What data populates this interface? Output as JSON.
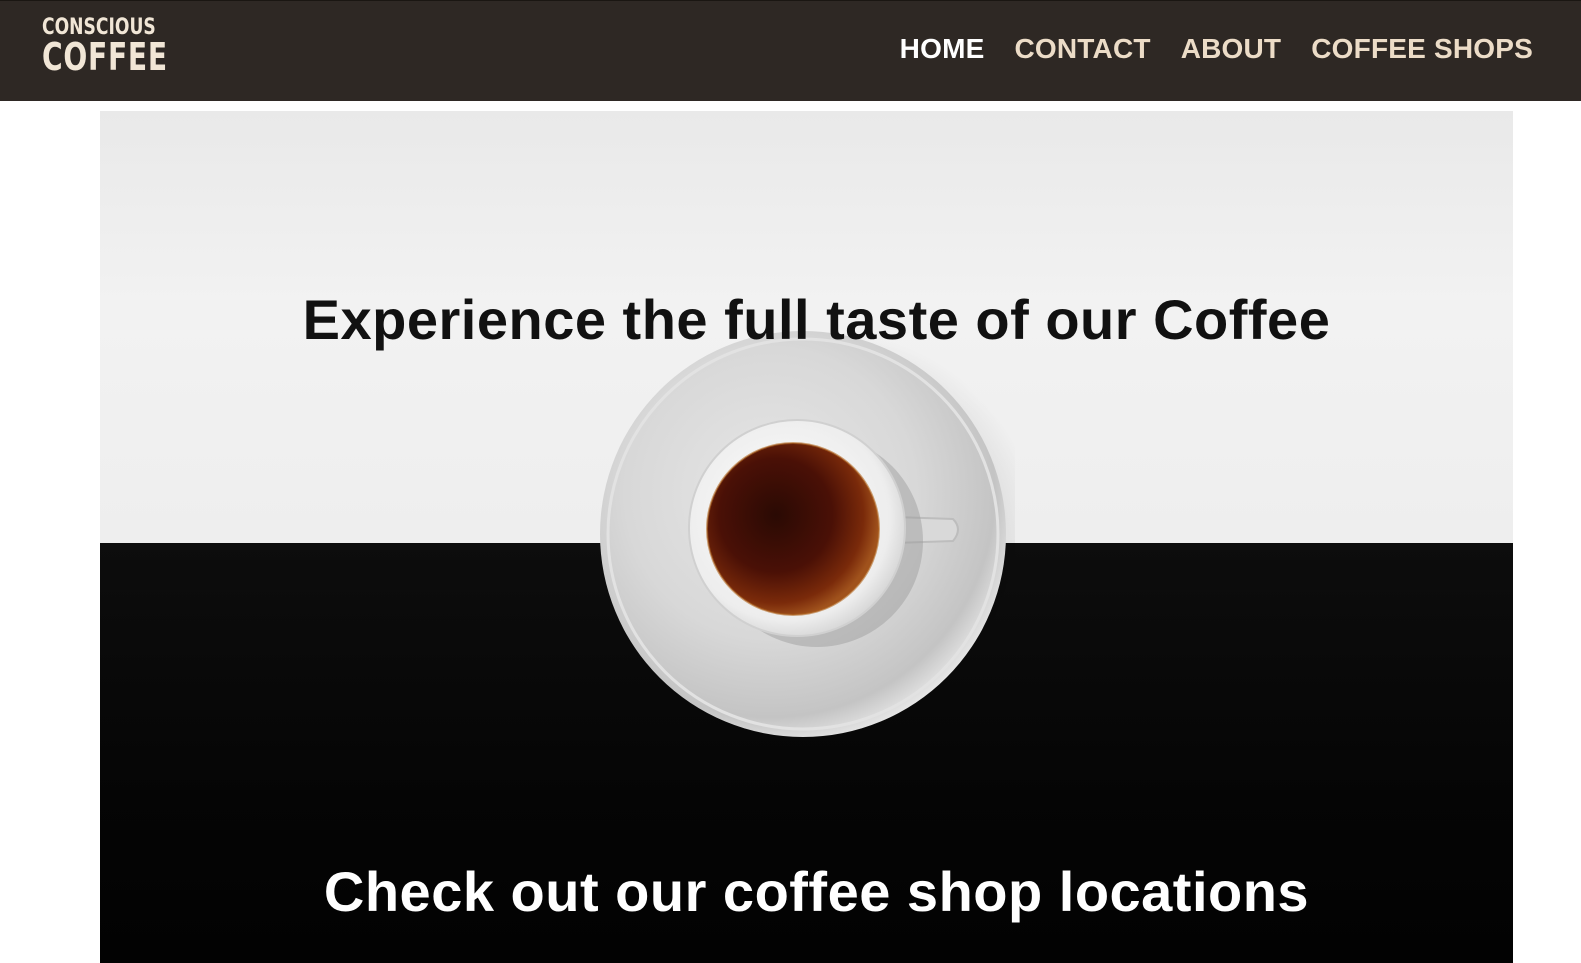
{
  "header": {
    "logo_line1": "CONSCIOUS",
    "logo_line2": "COFFEE",
    "nav": [
      {
        "label": "HOME",
        "active": true
      },
      {
        "label": "CONTACT",
        "active": false
      },
      {
        "label": "ABOUT",
        "active": false
      },
      {
        "label": "COFFEE SHOPS",
        "active": false
      }
    ]
  },
  "hero": {
    "headline": "Experience the full taste of our Coffee",
    "subheadline": "Check out our coffee shop locations",
    "image": "coffee-cup-top-view"
  },
  "colors": {
    "header_bg": "#2e2824",
    "logo_color": "#f1e6d6",
    "nav_color": "#ecdcc7",
    "nav_active_color": "#ffffff",
    "coffee_color": "#5a1405"
  }
}
